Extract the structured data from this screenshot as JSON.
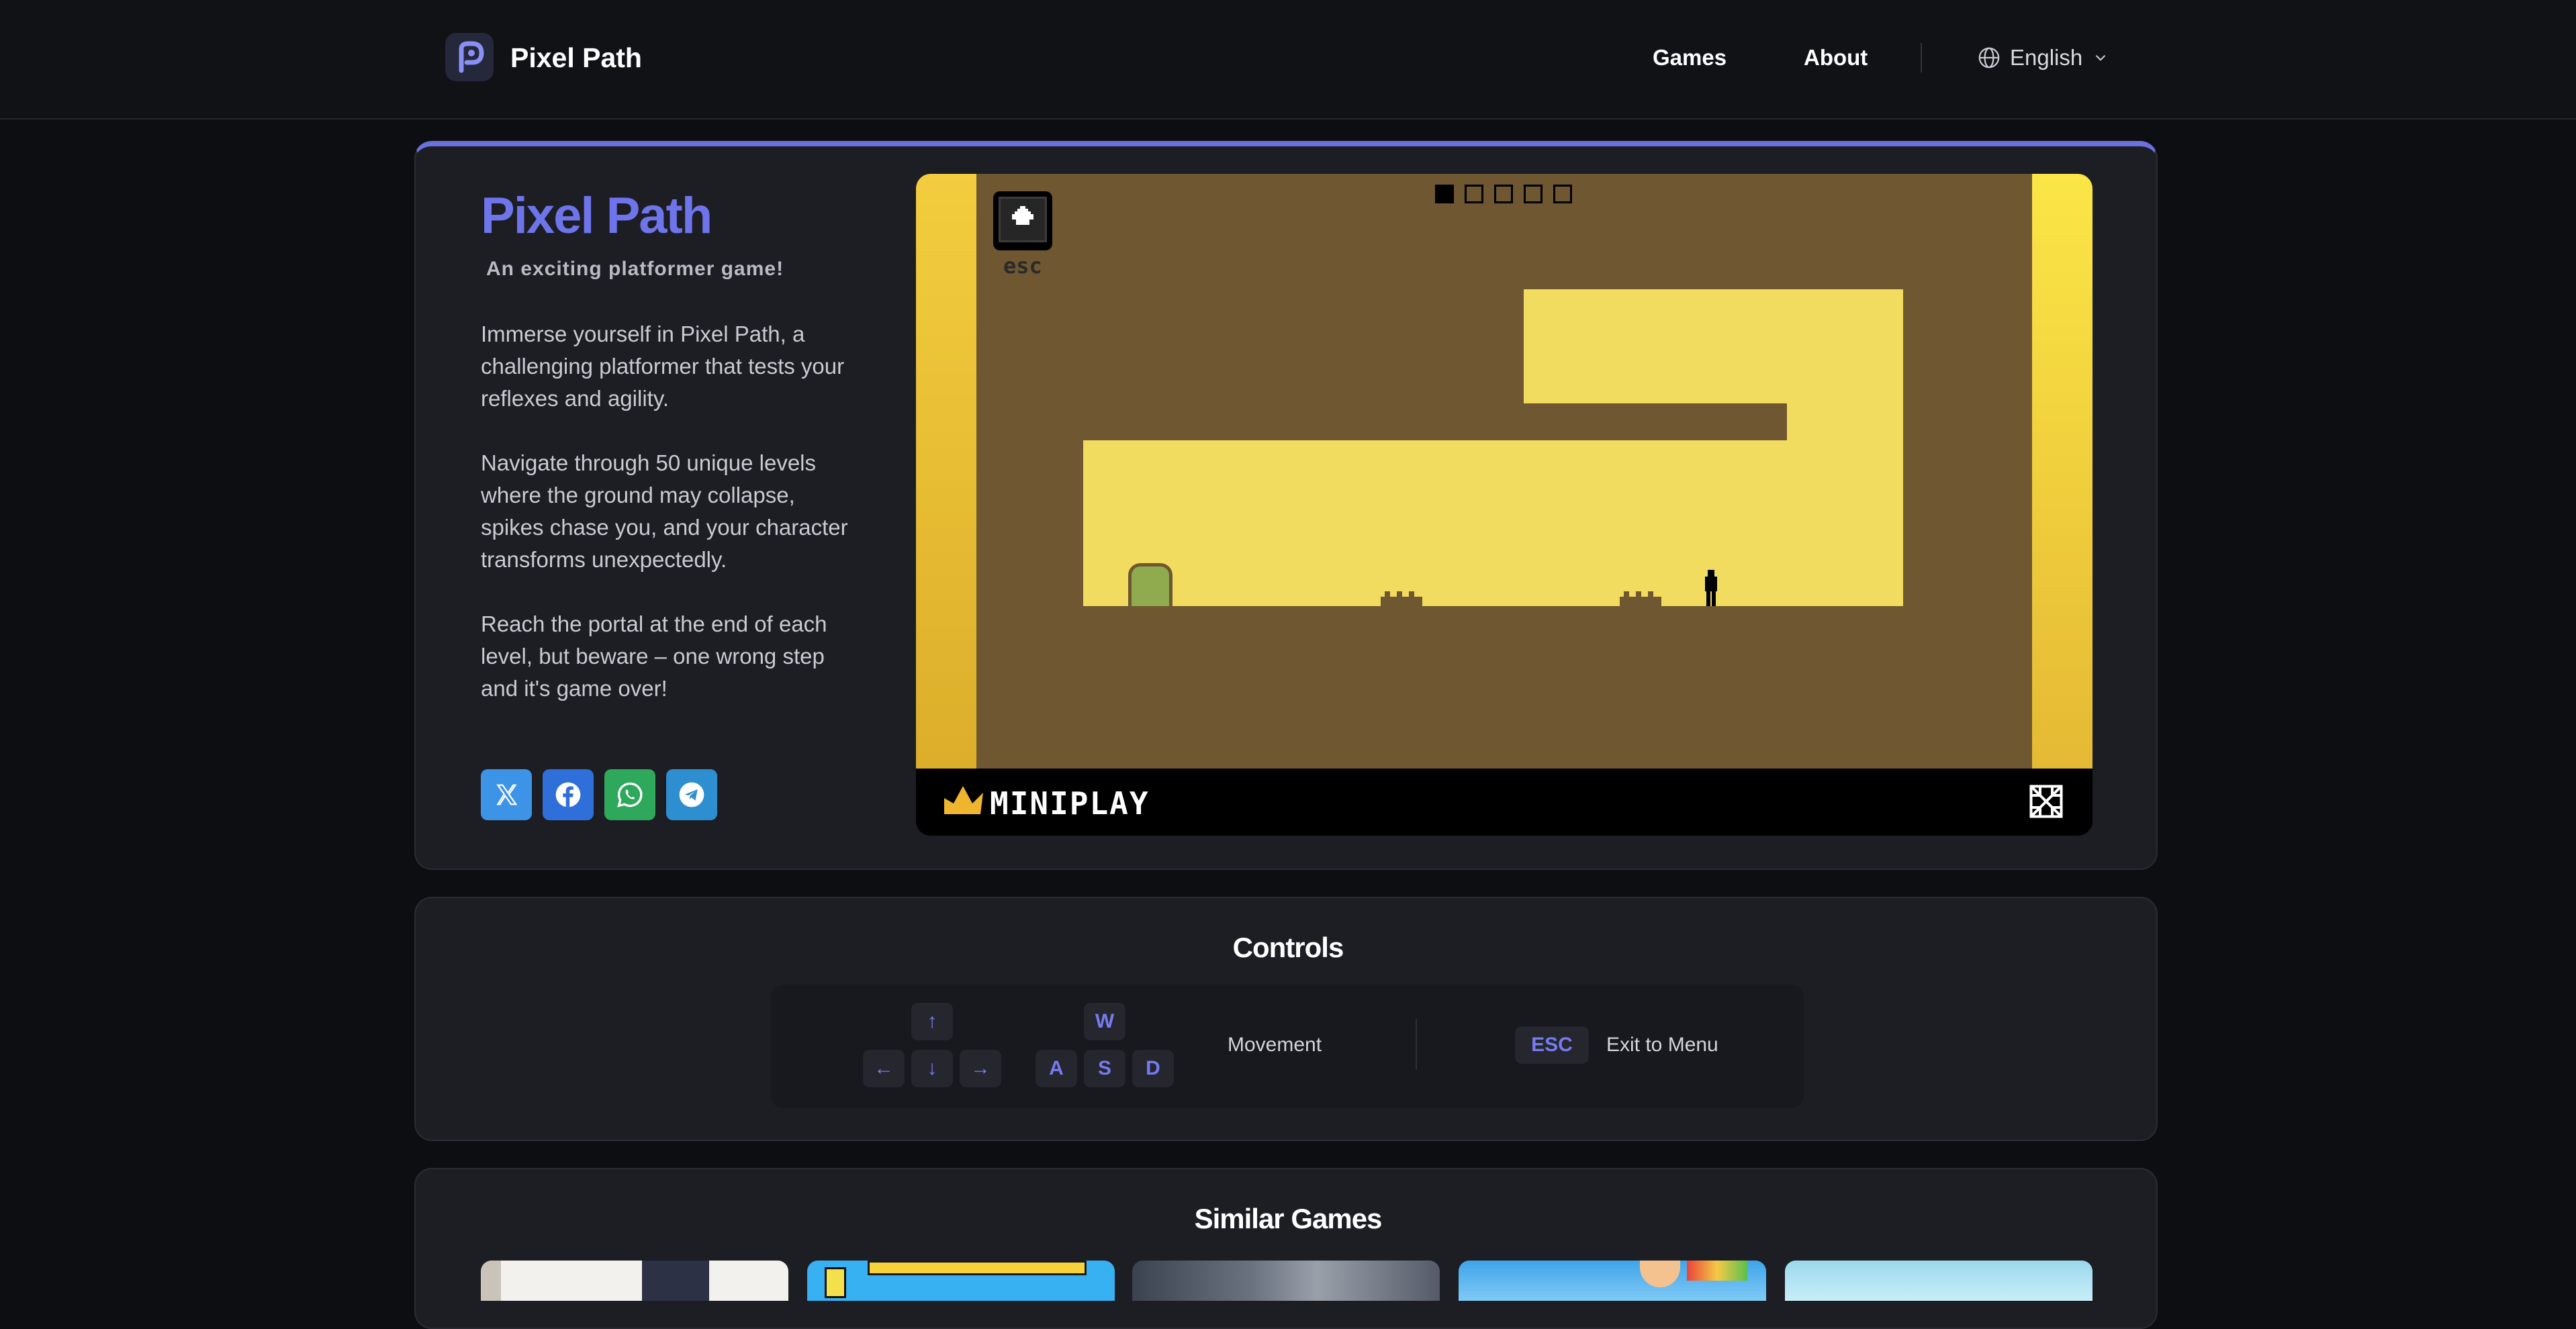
{
  "header": {
    "brand": "Pixel Path",
    "nav": [
      "Games",
      "About"
    ],
    "language": "English"
  },
  "game": {
    "title": "Pixel Path",
    "tagline": "An exciting platformer game!",
    "paragraphs": [
      "Immerse yourself in Pixel Path, a challenging platformer that tests your reflexes and agility.",
      "Navigate through 50 unique levels where the ground may collapse, spikes chase you, and your character transforms unexpectedly.",
      "Reach the portal at the end of each level, but beware – one wrong step and it's game over!"
    ],
    "share": [
      "x",
      "facebook",
      "whatsapp",
      "telegram"
    ],
    "esc_label": "esc",
    "level_progress": {
      "current": 1,
      "total": 5
    },
    "provider": "MINIPLAY"
  },
  "controls": {
    "title": "Controls",
    "movement_label": "Movement",
    "arrow_keys": [
      "↑",
      "←",
      "↓",
      "→"
    ],
    "wasd_keys": [
      "W",
      "A",
      "S",
      "D"
    ],
    "esc_key": "ESC",
    "exit_label": "Exit to Menu"
  },
  "similar": {
    "title": "Similar Games"
  },
  "colors": {
    "accent": "#6c71de",
    "background": "#0d0e12",
    "card": "#1d1e24",
    "game_dirt": "#6e5731",
    "game_sky": "#f2dc5f"
  }
}
